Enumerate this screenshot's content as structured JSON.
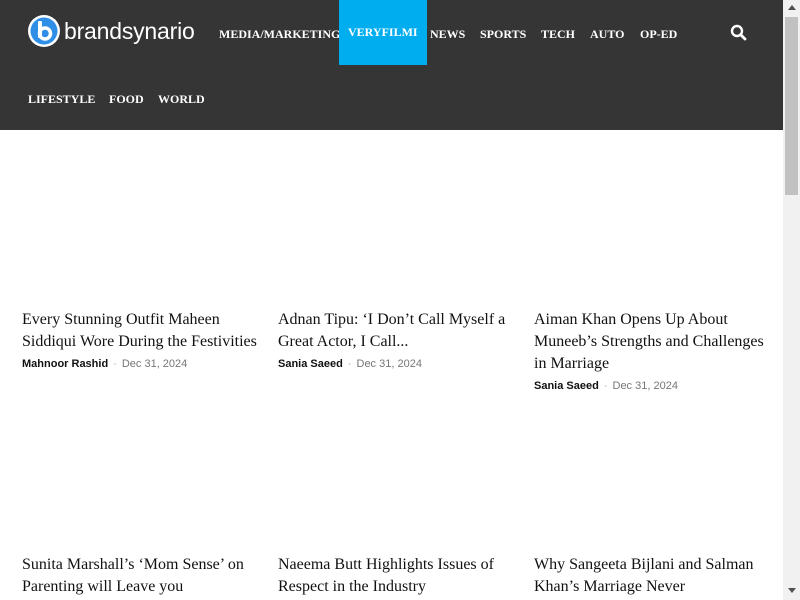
{
  "site": {
    "logo_text": "brandsynario",
    "logo_icon": "brandsynario-b-logo",
    "accent_color": "#00aeef",
    "header_bg": "#353535"
  },
  "nav": {
    "items": [
      {
        "label": "MEDIA/MARKETING"
      },
      {
        "label": "VERYFILMI",
        "active": true
      },
      {
        "label": "NEWS"
      },
      {
        "label": "SPORTS"
      },
      {
        "label": "TECH"
      },
      {
        "label": "AUTO"
      },
      {
        "label": "OP-ED"
      },
      {
        "label": "LIFESTYLE"
      },
      {
        "label": "FOOD"
      },
      {
        "label": "WORLD"
      }
    ],
    "search_icon": "search-icon"
  },
  "articles": [
    {
      "title": "Every Stunning Outfit Maheen Siddiqui Wore During the Festivities",
      "author": "Mahnoor Rashid",
      "separator": "-",
      "date": "Dec 31, 2024"
    },
    {
      "title": "Adnan Tipu: ‘I Don’t Call Myself a Great Actor, I Call...",
      "author": "Sania Saeed",
      "separator": "-",
      "date": "Dec 31, 2024"
    },
    {
      "title": "Aiman Khan Opens Up About Muneeb’s Strengths and Challenges in Marriage",
      "author": "Sania Saeed",
      "separator": "-",
      "date": "Dec 31, 2024"
    },
    {
      "title": "Sunita Marshall’s ‘Mom Sense’ on Parenting will Leave you",
      "author": "",
      "separator": "",
      "date": ""
    },
    {
      "title": "Naeema Butt Highlights Issues of Respect in the Industry",
      "author": "",
      "separator": "",
      "date": ""
    },
    {
      "title": "Why Sangeeta Bijlani and Salman Khan’s Marriage Never",
      "author": "",
      "separator": "",
      "date": ""
    }
  ]
}
